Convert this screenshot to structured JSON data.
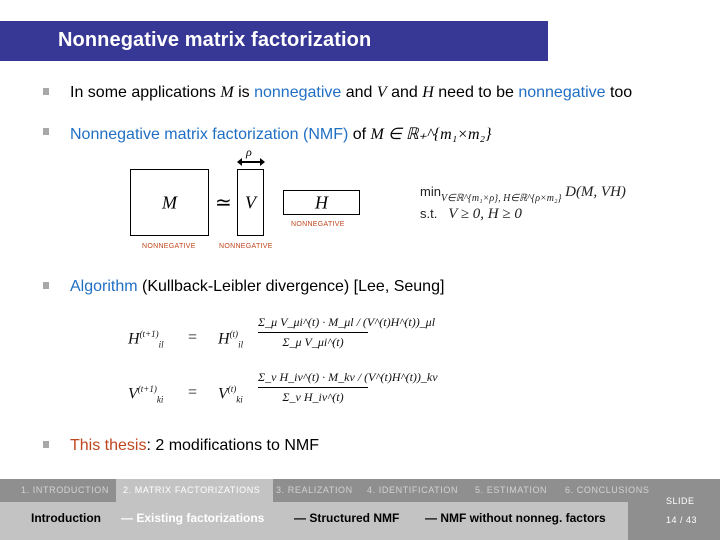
{
  "title": "Nonnegative matrix factorization",
  "bullets": [
    {
      "parts": [
        {
          "text": "In some applications ",
          "style": "plain"
        },
        {
          "text": "M",
          "style": "math"
        },
        {
          "text": " is ",
          "style": "plain"
        },
        {
          "text": "nonnegative",
          "style": "blue"
        },
        {
          "text": " and ",
          "style": "plain"
        },
        {
          "text": "V",
          "style": "math"
        },
        {
          "text": " and ",
          "style": "plain"
        },
        {
          "text": "H",
          "style": "math"
        },
        {
          "text": " need to be ",
          "style": "plain"
        },
        {
          "text": "nonnegative",
          "style": "blue"
        },
        {
          "text": " too",
          "style": "plain"
        }
      ]
    },
    {
      "parts": [
        {
          "text": "Nonnegative matrix factorization (NMF)",
          "style": "blue"
        },
        {
          "text": " of ",
          "style": "plain"
        },
        {
          "text": "M ∈ ℝ₊^{m₁×m₂}",
          "style": "math"
        }
      ]
    },
    {
      "parts": [
        {
          "text": "Algorithm",
          "style": "blue"
        },
        {
          "text": " (Kullback-Leibler divergence) [Lee, Seung]",
          "style": "plain"
        }
      ]
    },
    {
      "parts": [
        {
          "text": "This thesis",
          "style": "red"
        },
        {
          "text": ": 2 modifications to NMF",
          "style": "plain"
        }
      ]
    }
  ],
  "diagram": {
    "m_label": "M",
    "approx_symbol": "≃",
    "v_label": "V",
    "h_label": "H",
    "rho_label": "ρ",
    "nonneg_label": "NONNEGATIVE"
  },
  "optimization": {
    "min_label": "min",
    "min_subscript": "V∈ℝ^{m₁×ρ}, H∈ℝ^{ρ×m₂}",
    "objective": "D(M, VH)",
    "st_label": "s.t.",
    "constraint": "V ≥ 0, H ≥ 0"
  },
  "update_rules": [
    {
      "lhs": "H",
      "lhs_sup": "(t+1)",
      "lhs_sub": "il",
      "eq": "=",
      "rhs": "H",
      "rhs_sup": "(t)",
      "rhs_sub": "il",
      "numerator": "Σ_μ V_μi^(t) · M_μl / (V^(t)H^(t))_μl",
      "denominator": "Σ_μ V_μi^(t)"
    },
    {
      "lhs": "V",
      "lhs_sup": "(t+1)",
      "lhs_sub": "ki",
      "eq": "=",
      "rhs": "V",
      "rhs_sup": "(t)",
      "rhs_sub": "ki",
      "numerator": "Σ_ν H_iν^(t) · M_kν / (V^(t)H^(t))_kν",
      "denominator": "Σ_ν H_iν^(t)"
    }
  ],
  "footer": {
    "sections": [
      {
        "label": "1. INTRODUCTION",
        "active": false
      },
      {
        "label": "2. MATRIX FACTORIZATIONS",
        "active": true
      },
      {
        "label": "3. REALIZATION",
        "active": false
      },
      {
        "label": "4. IDENTIFICATION",
        "active": false
      },
      {
        "label": "5. ESTIMATION",
        "active": false
      },
      {
        "label": "6. CONCLUSIONS",
        "active": false
      }
    ],
    "subsections": [
      {
        "label": "Introduction",
        "active": false
      },
      {
        "label": "— Existing factorizations",
        "active": true
      },
      {
        "label": "— Structured NMF",
        "active": false
      },
      {
        "label": "— NMF without nonneg. factors",
        "active": false
      }
    ],
    "slide_label": "SLIDE",
    "slide_number": "14 / 43"
  },
  "colors": {
    "title_bar": "#373795",
    "highlight_blue": "#1f6fc4",
    "highlight_red": "#c0461e",
    "nav_dark": "#8f8f8f",
    "nav_light": "#c3c3c3"
  }
}
